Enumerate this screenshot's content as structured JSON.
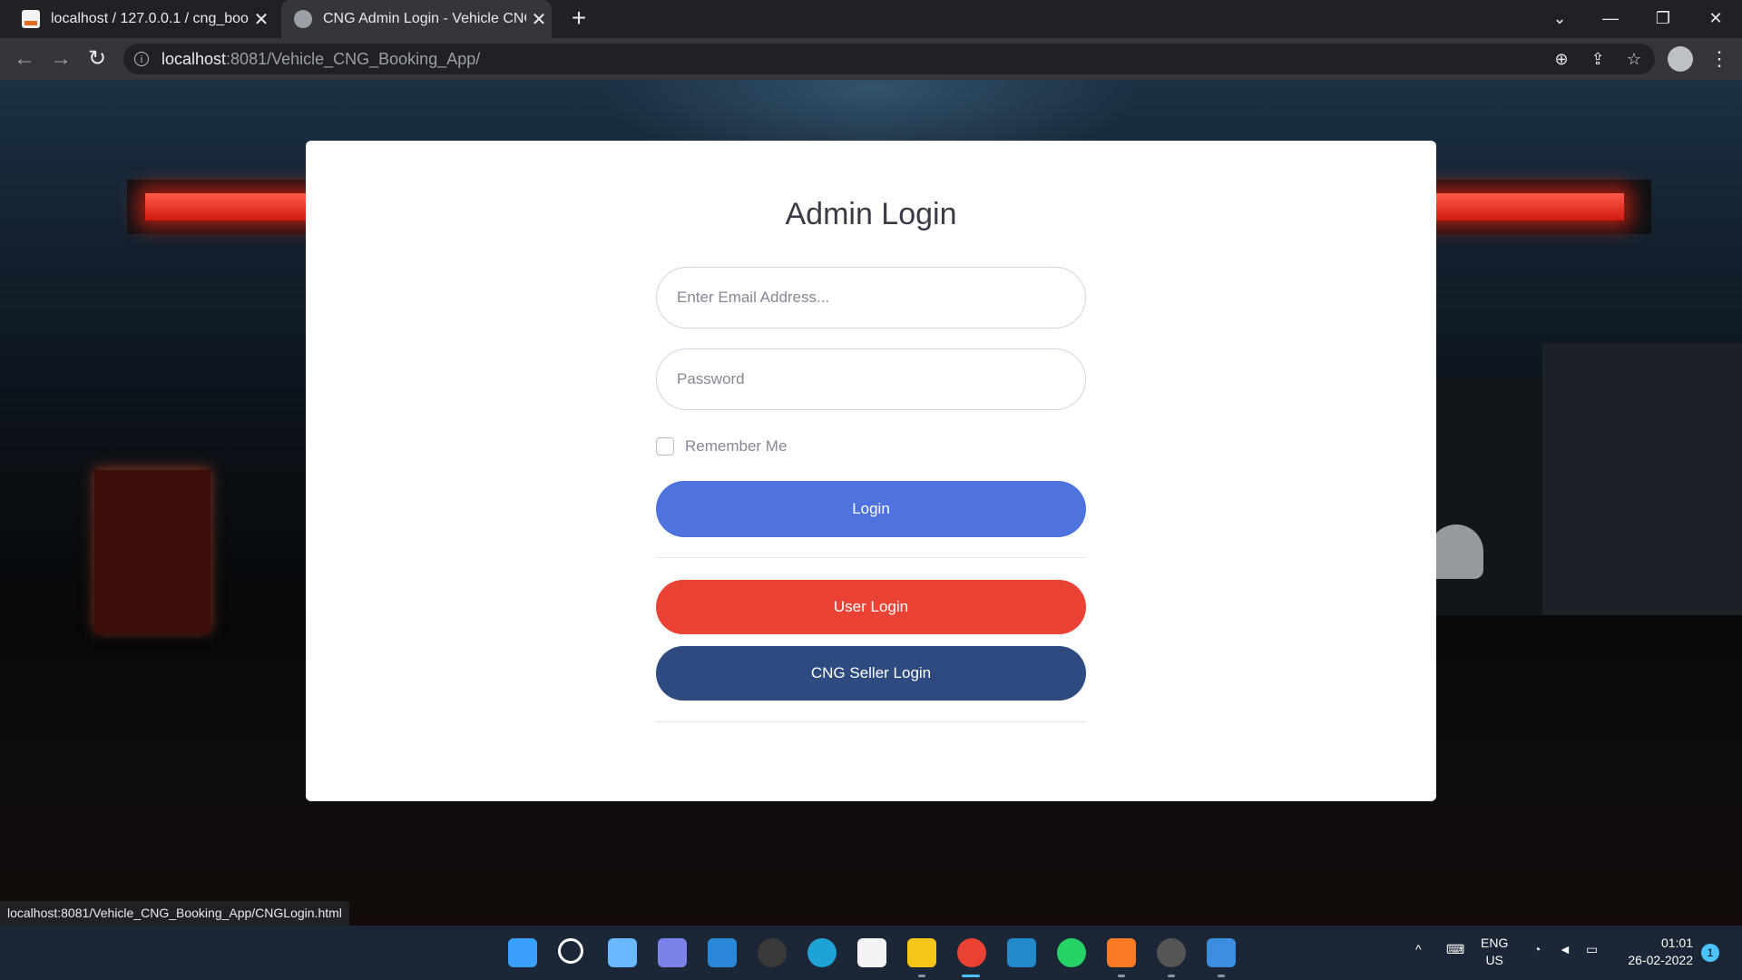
{
  "browser": {
    "tabs": [
      {
        "title": "localhost / 127.0.0.1 / cng_bookin",
        "close": "✕"
      },
      {
        "title": "CNG Admin Login - Vehicle CNG",
        "close": "✕"
      }
    ],
    "new_tab": "+",
    "url_host": "localhost",
    "url_rest": ":8081/Vehicle_CNG_Booking_App/"
  },
  "page": {
    "heading": "Admin Login",
    "email_placeholder": "Enter Email Address...",
    "password_placeholder": "Password",
    "remember_label": "Remember Me",
    "login_button": "Login",
    "user_login_button": "User Login",
    "seller_login_button": "CNG Seller Login"
  },
  "status_url": "localhost:8081/Vehicle_CNG_Booking_App/CNGLogin.html",
  "taskbar": {
    "lang_line1": "ENG",
    "lang_line2": "US",
    "time": "01:01",
    "date": "26-02-2022",
    "notifications": "1"
  },
  "colors": {
    "primary": "#4e73df",
    "google": "#ea4335",
    "seller": "#2e4a7f"
  }
}
